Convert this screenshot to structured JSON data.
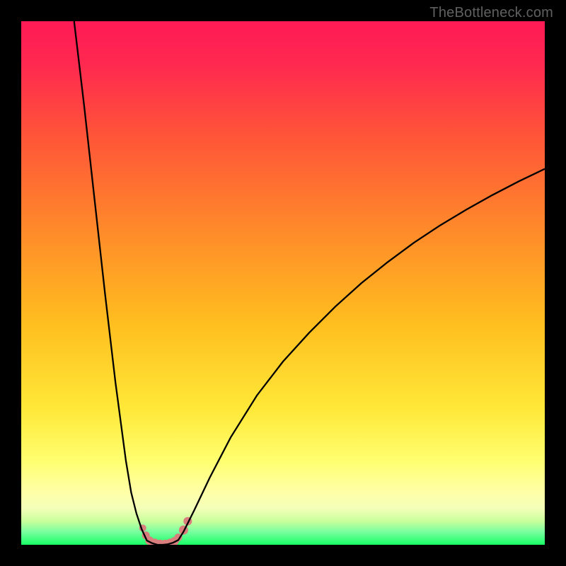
{
  "watermark": "TheBottleneck.com",
  "colors": {
    "frame_bg": "#000000",
    "grad_top": "#ff1a4d",
    "grad_mid1": "#ff6a2a",
    "grad_mid2": "#ffd21a",
    "grad_mid3": "#ffff66",
    "grad_green_light": "#d4ff80",
    "grad_green": "#2aff5a",
    "marker": "#d97d7d",
    "curve": "#000000"
  },
  "chart_data": {
    "type": "line",
    "title": "",
    "xlabel": "",
    "ylabel": "",
    "xlim": [
      0,
      100
    ],
    "ylim": [
      0,
      100
    ],
    "note": "V-shaped bottleneck curve. Minimum (0) around x≈24–30. Left arm rises steeply to y=100 at x≈10. Right arm rises with diminishing slope, y≈72 at x=100. Background is a vertical red→orange→yellow→green gradient; green band marks low bottleneck near y=0.",
    "series": [
      {
        "name": "left_arm",
        "x": [
          10.1,
          12,
          14,
          16,
          18,
          20,
          21,
          22,
          23,
          24
        ],
        "y": [
          100,
          84,
          66,
          48,
          31,
          16,
          10,
          6,
          3,
          0.8
        ]
      },
      {
        "name": "valley",
        "x": [
          24,
          25,
          26,
          27,
          28,
          29,
          30
        ],
        "y": [
          0.8,
          0.3,
          0.0,
          0.0,
          0.1,
          0.4,
          0.9
        ]
      },
      {
        "name": "right_arm",
        "x": [
          30,
          31,
          33,
          36,
          40,
          45,
          50,
          55,
          60,
          65,
          70,
          75,
          80,
          85,
          90,
          95,
          100
        ],
        "y": [
          0.9,
          2.5,
          6.5,
          12.8,
          20.5,
          28.5,
          35,
          40.5,
          45.5,
          50,
          54,
          57.7,
          61,
          64,
          66.8,
          69.4,
          71.8
        ]
      }
    ],
    "markers": {
      "name": "highlighted_points",
      "x": [
        23.2,
        23.8,
        24.5,
        25.5,
        26.5,
        27.5,
        28.5,
        29.3,
        30.0,
        31.0,
        31.8
      ],
      "y": [
        3.2,
        1.8,
        0.8,
        0.3,
        0.1,
        0.1,
        0.3,
        0.7,
        1.4,
        2.8,
        4.5
      ],
      "r": [
        5,
        5.5,
        6,
        6.5,
        6.5,
        6.5,
        6.5,
        6,
        5.5,
        6.5,
        6
      ]
    }
  }
}
